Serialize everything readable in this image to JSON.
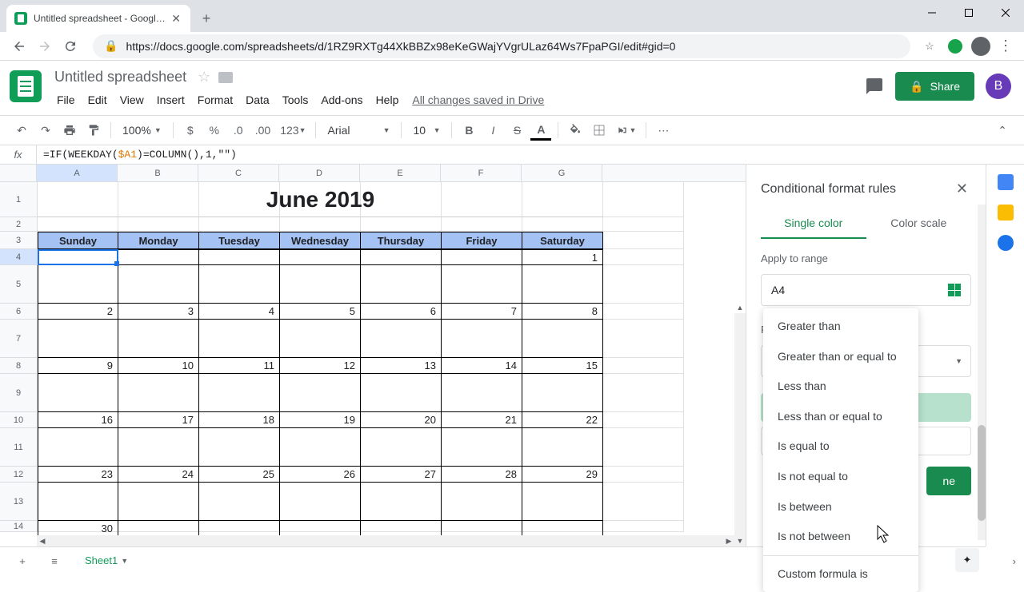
{
  "browser": {
    "tab_title": "Untitled spreadsheet - Google S",
    "url": "https://docs.google.com/spreadsheets/d/1RZ9RXTg44XkBBZx98eKeGWajYVgrULaz64Ws7FpaPGI/edit#gid=0"
  },
  "doc": {
    "title": "Untitled spreadsheet",
    "menus": [
      "File",
      "Edit",
      "View",
      "Insert",
      "Format",
      "Data",
      "Tools",
      "Add-ons",
      "Help"
    ],
    "drive_status": "All changes saved in Drive",
    "share_label": "Share",
    "user_initial": "B"
  },
  "toolbar": {
    "zoom": "100%",
    "font": "Arial",
    "font_size": "10"
  },
  "formula": {
    "prefix": "=IF(WEEKDAY(",
    "ref": "$A1",
    "suffix": ")=COLUMN(),1,\"\")"
  },
  "grid": {
    "columns": [
      "A",
      "B",
      "C",
      "D",
      "E",
      "F",
      "G"
    ],
    "row_numbers": [
      "1",
      "2",
      "3",
      "4",
      "5",
      "6",
      "7",
      "8",
      "9",
      "10",
      "11",
      "12",
      "13",
      "14"
    ],
    "title": "June 2019",
    "days": [
      "Sunday",
      "Monday",
      "Tuesday",
      "Wednesday",
      "Thursday",
      "Friday",
      "Saturday"
    ],
    "weeks": [
      [
        "",
        "",
        "",
        "",
        "",
        "",
        "1"
      ],
      [
        "2",
        "3",
        "4",
        "5",
        "6",
        "7",
        "8"
      ],
      [
        "9",
        "10",
        "11",
        "12",
        "13",
        "14",
        "15"
      ],
      [
        "16",
        "17",
        "18",
        "19",
        "20",
        "21",
        "22"
      ],
      [
        "23",
        "24",
        "25",
        "26",
        "27",
        "28",
        "29"
      ],
      [
        "30",
        "",
        "",
        "",
        "",
        "",
        ""
      ]
    ]
  },
  "panel": {
    "title": "Conditional format rules",
    "tab_single": "Single color",
    "tab_scale": "Color scale",
    "apply_label": "Apply to range",
    "range_value": "A4",
    "rules_label": "Format rules",
    "done_label": "ne",
    "dropdown": {
      "items": [
        "Greater than",
        "Greater than or equal to",
        "Less than",
        "Less than or equal to",
        "Is equal to",
        "Is not equal to",
        "Is between",
        "Is not between"
      ],
      "last": "Custom formula is"
    }
  },
  "footer": {
    "sheet_name": "Sheet1"
  }
}
